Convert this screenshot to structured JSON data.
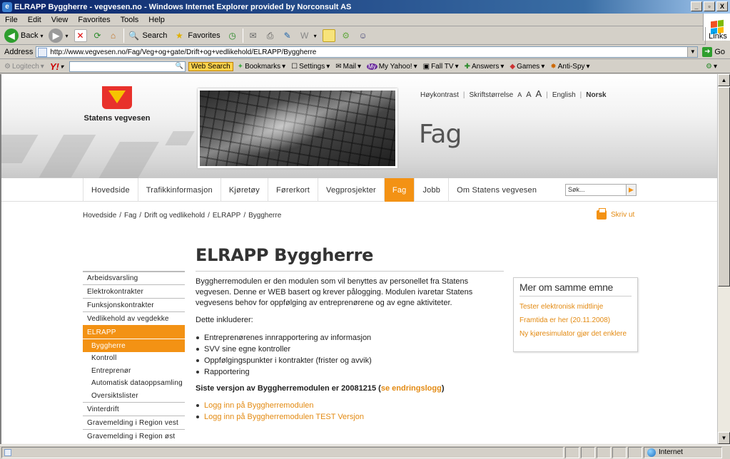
{
  "window": {
    "title": "ELRAPP Byggherre - vegvesen.no - Windows Internet Explorer provided by Norconsult AS",
    "buttons": [
      "_",
      "▫",
      "X"
    ]
  },
  "menubar": [
    "File",
    "Edit",
    "View",
    "Favorites",
    "Tools",
    "Help"
  ],
  "toolbar": {
    "back": "Back",
    "search": "Search",
    "favorites": "Favorites",
    "links": "Links"
  },
  "address": {
    "label": "Address",
    "url": "http://www.vegvesen.no/Fag/Veg+og+gate/Drift+og+vedlikehold/ELRAPP/Byggherre",
    "go": "Go"
  },
  "ytoolbar": {
    "logitech": "Logitech",
    "yahoo": "Y!",
    "web_search": "Web Search",
    "bookmarks": "Bookmarks",
    "settings": "Settings",
    "mail": "Mail",
    "my_yahoo": "My Yahoo!",
    "fall_tv": "Fall TV",
    "answers": "Answers",
    "games": "Games",
    "anti_spy": "Anti-Spy"
  },
  "status": {
    "zone": "Internet"
  },
  "page": {
    "logo_name": "Statens vegvesen",
    "section_title": "Fag",
    "utility": {
      "contrast": "Høykontrast",
      "fontsize": "Skriftstørrelse",
      "fontsizes": [
        "A",
        "A",
        "A"
      ],
      "english": "English",
      "norsk": "Norsk"
    },
    "nav": [
      {
        "label": "Hovedside",
        "active": false
      },
      {
        "label": "Trafikkinformasjon",
        "active": false
      },
      {
        "label": "Kjøretøy",
        "active": false
      },
      {
        "label": "Førerkort",
        "active": false
      },
      {
        "label": "Vegprosjekter",
        "active": false
      },
      {
        "label": "Fag",
        "active": true
      },
      {
        "label": "Jobb",
        "active": false
      },
      {
        "label": "Om Statens vegvesen",
        "active": false
      }
    ],
    "search_placeholder": "Søk...",
    "breadcrumb": [
      "Hovedside",
      "Fag",
      "Drift og vedlikehold",
      "ELRAPP",
      "Byggherre"
    ],
    "print": "Skriv ut",
    "leftmenu": [
      {
        "label": "Arbeidsvarsling",
        "type": "item"
      },
      {
        "label": "Elektrokontrakter",
        "type": "item"
      },
      {
        "label": "Funksjonskontrakter",
        "type": "item"
      },
      {
        "label": "Vedlikehold av vegdekke",
        "type": "item"
      },
      {
        "label": "ELRAPP",
        "type": "section"
      },
      {
        "label": "Byggherre",
        "type": "subactive"
      },
      {
        "label": "Kontroll",
        "type": "sub"
      },
      {
        "label": "Entreprenør",
        "type": "sub"
      },
      {
        "label": "Automatisk dataoppsamling",
        "type": "sub"
      },
      {
        "label": "Oversiktslister",
        "type": "sub"
      },
      {
        "label": "Vinterdrift",
        "type": "item"
      },
      {
        "label": "Gravemelding i Region vest",
        "type": "item"
      },
      {
        "label": "Gravemelding i Region øst",
        "type": "item"
      }
    ],
    "main": {
      "title": "ELRAPP Byggherre",
      "intro": "Byggherremodulen er den modulen som vil benyttes av personellet fra Statens vegvesen. Denne er WEB basert og krever pålogging. Modulen ivaretar Statens vegvesens behov for oppfølging av entreprenørene og av egne aktiviteter.",
      "includes": "Dette inkluderer:",
      "bullets": [
        "Entreprenørenes innrapportering av informasjon",
        "SVV sine egne kontroller",
        "Oppfølgingspunkter i kontrakter (frister og avvik)",
        "Rapportering"
      ],
      "version_text": "Siste versjon av Byggherremodulen er 20081215 (",
      "version_link": "se endringslogg",
      "version_end": ")",
      "links": [
        "Logg inn på Byggherremodulen",
        "Logg inn på Byggherremodulen TEST Versjon"
      ]
    },
    "related": {
      "title": "Mer om samme emne",
      "links": [
        "Tester elektronisk midtlinje",
        "Framtida er her (20.11.2008)",
        "Ny kjøresimulator gjør det enklere"
      ]
    }
  },
  "colors": {
    "accent": "#f39214",
    "link": "#e38a12",
    "titlebar": "#0a246a"
  }
}
